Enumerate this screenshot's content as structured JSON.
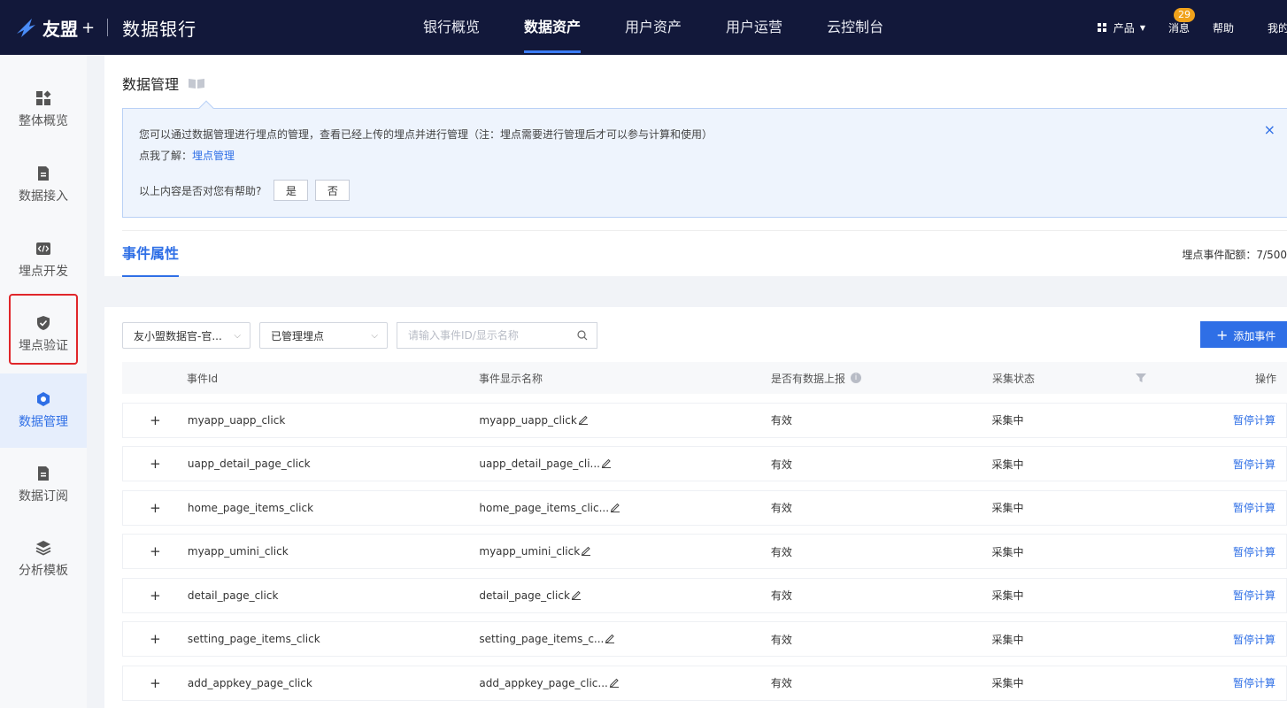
{
  "topbar": {
    "brand_name": "友盟",
    "brand_plus": "+",
    "app_name": "数据银行",
    "nav": [
      "银行概览",
      "数据资产",
      "用户资产",
      "用户运营",
      "云控制台"
    ],
    "active_nav": 1,
    "product_label": "产品",
    "messages_label": "消息",
    "messages_count": "29",
    "help_label": "帮助",
    "mine_label": "我的"
  },
  "sidebar": {
    "items": [
      {
        "label": "整体概览",
        "icon": "dashboard-icon"
      },
      {
        "label": "数据接入",
        "icon": "document-icon"
      },
      {
        "label": "埋点开发",
        "icon": "code-icon"
      },
      {
        "label": "埋点验证",
        "icon": "shield-check-icon"
      },
      {
        "label": "数据管理",
        "icon": "hexagon-icon"
      },
      {
        "label": "数据订阅",
        "icon": "document-icon"
      },
      {
        "label": "分析模板",
        "icon": "layers-icon"
      }
    ],
    "active_index": 4,
    "highlighted_index": 3
  },
  "page": {
    "title": "数据管理",
    "notice": {
      "text": "您可以通过数据管理进行埋点的管理，查看已经上传的埋点并进行管理（注：埋点需要进行管理后才可以参与计算和使用）",
      "learn_prefix": "点我了解：",
      "learn_link": "埋点管理",
      "helpful_question": "以上内容是否对您有帮助?",
      "yes": "是",
      "no": "否",
      "close": "×"
    },
    "tab": "事件属性",
    "quota": "埋点事件配额：7/500"
  },
  "filters": {
    "app_select": "友小盟数据官-官...",
    "status_select": "已管理埋点",
    "search_placeholder": "请输入事件ID/显示名称",
    "add_button": "添加事件",
    "add_plus": "+"
  },
  "table": {
    "columns": [
      "事件Id",
      "事件显示名称",
      "是否有数据上报",
      "采集状态",
      "操作"
    ],
    "rows": [
      {
        "id": "myapp_uapp_click",
        "name": "myapp_uapp_click",
        "reported": "有效",
        "status": "采集中",
        "action": "暂停计算"
      },
      {
        "id": "uapp_detail_page_click",
        "name": "uapp_detail_page_cli...",
        "reported": "有效",
        "status": "采集中",
        "action": "暂停计算"
      },
      {
        "id": "home_page_items_click",
        "name": "home_page_items_clic...",
        "reported": "有效",
        "status": "采集中",
        "action": "暂停计算"
      },
      {
        "id": "myapp_umini_click",
        "name": "myapp_umini_click",
        "reported": "有效",
        "status": "采集中",
        "action": "暂停计算"
      },
      {
        "id": "detail_page_click",
        "name": "detail_page_click",
        "reported": "有效",
        "status": "采集中",
        "action": "暂停计算"
      },
      {
        "id": "setting_page_items_click",
        "name": "setting_page_items_c...",
        "reported": "有效",
        "status": "采集中",
        "action": "暂停计算"
      },
      {
        "id": "add_appkey_page_click",
        "name": "add_appkey_page_clic...",
        "reported": "有效",
        "status": "采集中",
        "action": "暂停计算"
      }
    ],
    "expand_symbol": "+",
    "info_symbol": "i"
  },
  "colors": {
    "topbar": "#12183a",
    "accent": "#2f6fe6",
    "highlight": "#e0262a",
    "badge": "#f0a21b"
  }
}
